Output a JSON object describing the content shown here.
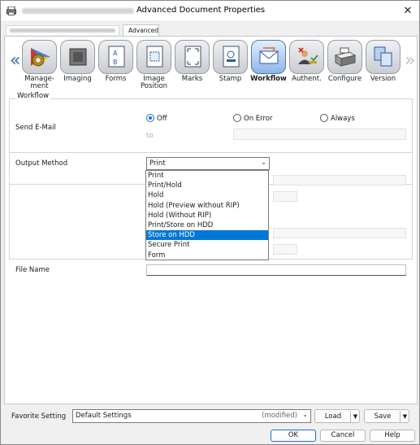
{
  "window": {
    "title": "Advanced Document Properties",
    "close_glyph": "✕"
  },
  "tabs": {
    "advanced": "Advanced"
  },
  "ribbon": {
    "items": [
      {
        "label": "Manage-\nment",
        "icon": "gear-palette-icon"
      },
      {
        "label": "Imaging",
        "icon": "grey-box-icon"
      },
      {
        "label": "Forms",
        "icon": "form-icon"
      },
      {
        "label": "Image\nPosition",
        "icon": "image-position-icon"
      },
      {
        "label": "Marks",
        "icon": "marks-icon"
      },
      {
        "label": "Stamp",
        "icon": "stamp-icon"
      },
      {
        "label": "Workflow",
        "icon": "mail-envelope-icon"
      },
      {
        "label": "Authent.",
        "icon": "users-key-icon"
      },
      {
        "label": "Configure",
        "icon": "printer-config-icon"
      },
      {
        "label": "Version",
        "icon": "version-icon"
      }
    ],
    "left_arrow": "«",
    "right_arrow": "»"
  },
  "workflow": {
    "section_title": "Workflow",
    "send_email_label": "Send E-Mail",
    "radio_off": "Off",
    "radio_on_error": "On Error",
    "radio_always": "Always",
    "to_label": "to",
    "output_method_label": "Output Method",
    "output_method_value": "Print",
    "options": [
      "Print",
      "Print/Hold",
      "Hold",
      "Hold (Preview without RIP)",
      "Hold (Without RIP)",
      "Print/Store on HDD",
      "Store on HDD",
      "Secure Print",
      "Form"
    ],
    "file_name_label": "File Name"
  },
  "footer": {
    "favorite_label": "Favorite Setting",
    "favorite_value": "Default Settings",
    "favorite_modified": "(modified)",
    "load": "Load",
    "save": "Save",
    "ok": "OK",
    "cancel": "Cancel",
    "help": "Help"
  }
}
